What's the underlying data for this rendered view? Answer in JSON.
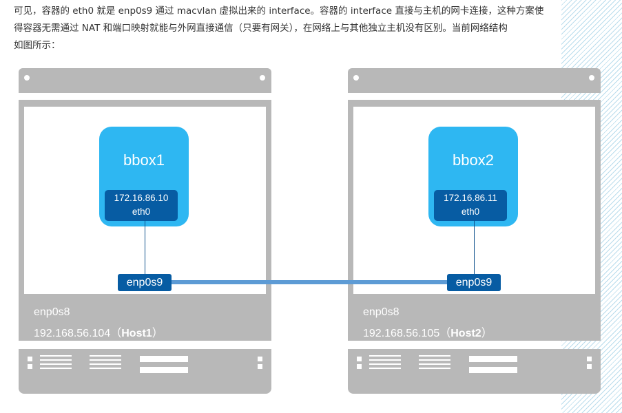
{
  "paragraph": {
    "line1": "可见，容器的 eth0 就是 enp0s9 通过 macvlan 虚拟出来的 interface。容器的 interface 直接与主机的网卡连接，这种方案使",
    "line2": "得容器无需通过 NAT 和端口映射就能与外网直接通信（只要有网关），在网络上与其他独立主机没有区别。当前网络结构",
    "line3": "如图所示："
  },
  "diagram": {
    "hosts": [
      {
        "host_nic": "enp0s8",
        "host_ip": "192.168.56.104（",
        "host_name": "Host1",
        "host_close": "）",
        "container_name": "bbox1",
        "container_ip": "172.16.86.10",
        "container_iface": "eth0",
        "macvlan_parent": "enp0s9"
      },
      {
        "host_nic": "enp0s8",
        "host_ip": "192.168.56.105（",
        "host_name": "Host2",
        "host_close": "）",
        "container_name": "bbox2",
        "container_ip": "172.16.86.11",
        "container_iface": "eth0",
        "macvlan_parent": "enp0s9"
      }
    ],
    "colors": {
      "host_gray": "#b8b8b8",
      "container_blue": "#2eb7f2",
      "interface_navy": "#075ca3",
      "link_blue": "#5d9bd5"
    }
  }
}
